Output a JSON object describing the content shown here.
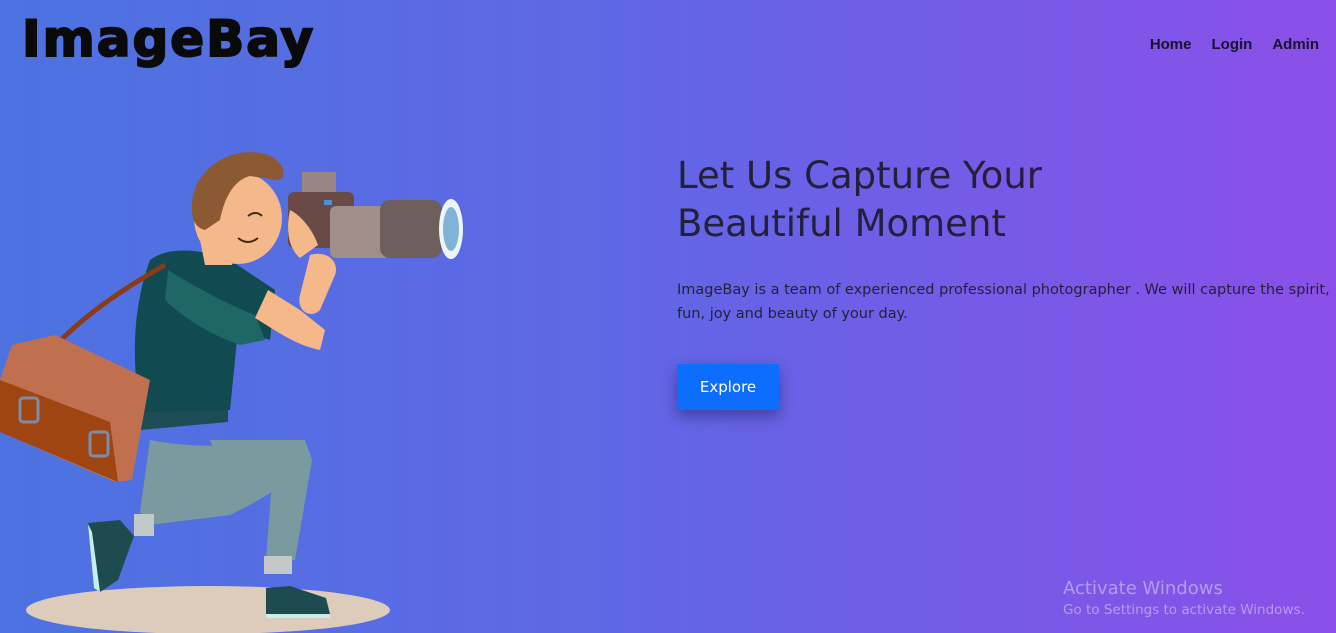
{
  "brand": {
    "name": "ImageBay"
  },
  "nav": {
    "items": [
      "Home",
      "Login",
      "Admin"
    ]
  },
  "hero": {
    "title_line1": "Let Us Capture Your",
    "title_line2": "Beautiful Moment",
    "description": "ImageBay is a team of experienced professional photographer . We will capture the spirit, fun, joy and beauty of your day.",
    "button_label": "Explore"
  },
  "illustration": {
    "icon": "photographer-illustration"
  },
  "watermark": {
    "line1": "Activate Windows",
    "line2": "Go to Settings to activate Windows."
  },
  "colors": {
    "gradient_start": "#4c73e0",
    "gradient_end": "#8b4fe8",
    "button": "#0d6efd",
    "text": "#23213a"
  }
}
